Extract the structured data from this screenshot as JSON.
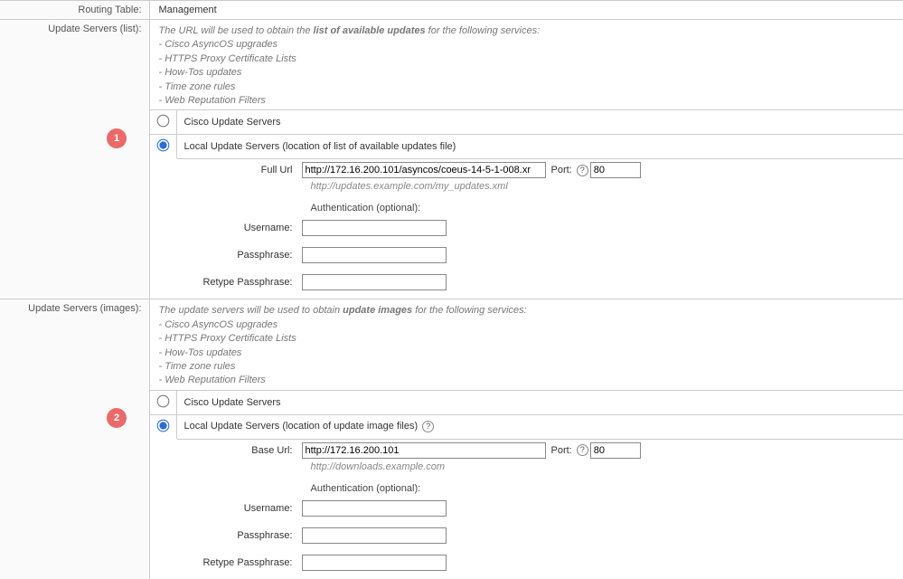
{
  "routingTable": {
    "label": "Routing Table:",
    "value": "Management"
  },
  "listSection": {
    "label": "Update Servers (list):",
    "desc": {
      "intro": "The URL will be used to obtain the ",
      "bold": "list of available updates",
      "outro": " for the following services:",
      "items": [
        "- Cisco AsyncOS upgrades",
        "- HTTPS Proxy Certificate Lists",
        "- How-Tos updates",
        "- Time zone rules",
        "- Web Reputation Filters"
      ]
    },
    "optionCisco": "Cisco Update Servers",
    "optionLocal": "Local Update Servers (location of list of available updates file)",
    "fullUrlLabel": "Full Url",
    "fullUrlValue": "http://172.16.200.101/asyncos/coeus-14-5-1-008.xr",
    "fullUrlHint": "http://updates.example.com/my_updates.xml",
    "portLabel": "Port:",
    "portValue": "80",
    "authHeader": "Authentication (optional):",
    "usernameLabel": "Username:",
    "passphraseLabel": "Passphrase:",
    "retypeLabel": "Retype Passphrase:",
    "callout": "1"
  },
  "imagesSection": {
    "label": "Update Servers (images):",
    "desc": {
      "intro": "The update servers will be used to obtain ",
      "bold": "update images",
      "outro": " for the following services:",
      "items": [
        "- Cisco AsyncOS upgrades",
        "- HTTPS Proxy Certificate Lists",
        "- How-Tos updates",
        "- Time zone rules",
        "- Web Reputation Filters"
      ]
    },
    "optionCisco": "Cisco Update Servers",
    "optionLocal": "Local Update Servers (location of update image files)",
    "baseUrlLabel": "Base Url:",
    "baseUrlValue": "http://172.16.200.101",
    "baseUrlHint": "http://downloads.example.com",
    "portLabel": "Port:",
    "portValue": "80",
    "authHeader": "Authentication (optional):",
    "usernameLabel": "Username:",
    "passphraseLabel": "Passphrase:",
    "retypeLabel": "Retype Passphrase:",
    "callout": "2"
  },
  "help": "?"
}
